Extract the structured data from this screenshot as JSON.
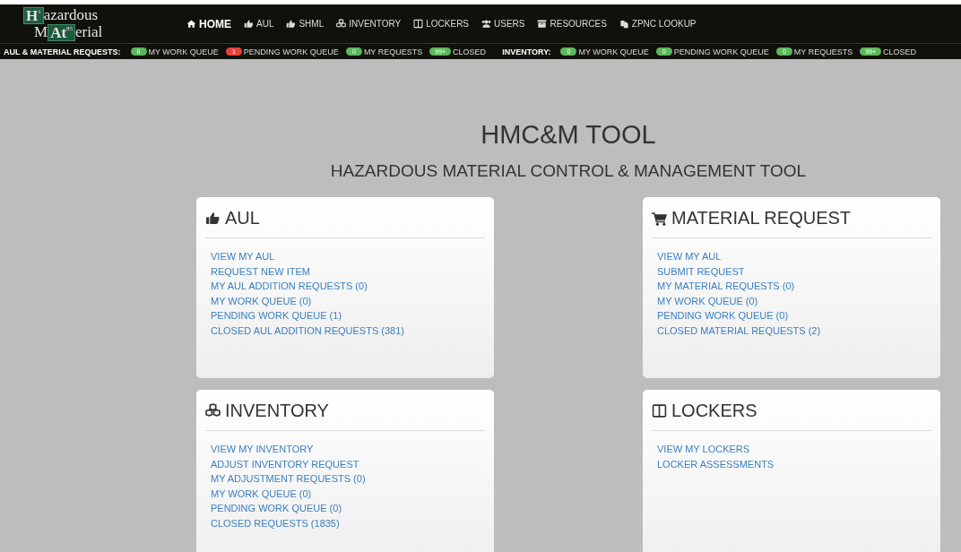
{
  "logo": {
    "lines": [
      {
        "boxed": "H",
        "mark": "1",
        "after": "azardous"
      },
      {
        "before": "M",
        "boxed": "At",
        "mark": "85",
        "after": "erial"
      }
    ]
  },
  "nav": [
    {
      "label": "HOME",
      "kind": "home",
      "selected": true
    },
    {
      "label": "AUL",
      "kind": "thumb",
      "selected": false
    },
    {
      "label": "SHML",
      "kind": "thumb",
      "selected": false
    },
    {
      "label": "INVENTORY",
      "kind": "cubes",
      "selected": false
    },
    {
      "label": "LOCKERS",
      "kind": "columns",
      "selected": false
    },
    {
      "label": "USERS",
      "kind": "users",
      "selected": false
    },
    {
      "label": "RESOURCES",
      "kind": "archive",
      "selected": false
    },
    {
      "label": "ZPNC LOOKUP",
      "kind": "copy",
      "selected": false
    }
  ],
  "status_bar": [
    {
      "label": "AUL & MATERIAL REQUESTS:",
      "items": [
        {
          "count": "0",
          "color": "#5cb85c",
          "text": "MY WORK QUEUE"
        },
        {
          "count": "1",
          "color": "#e8433a",
          "text": "PENDING WORK QUEUE"
        },
        {
          "count": "0",
          "color": "#5cb85c",
          "text": "MY REQUESTS"
        },
        {
          "count": "99+",
          "color": "#5cb85c",
          "text": "CLOSED"
        }
      ]
    },
    {
      "label": "INVENTORY:",
      "items": [
        {
          "count": "0",
          "color": "#5cb85c",
          "text": "MY WORK QUEUE"
        },
        {
          "count": "0",
          "color": "#5cb85c",
          "text": "PENDING WORK QUEUE"
        },
        {
          "count": "0",
          "color": "#5cb85c",
          "text": "MY REQUESTS"
        },
        {
          "count": "99+",
          "color": "#5cb85c",
          "text": "CLOSED"
        }
      ]
    }
  ],
  "title": "HMC&M TOOL",
  "subtitle": "HAZARDOUS MATERIAL CONTROL & MANAGEMENT TOOL",
  "cards": [
    {
      "title": "AUL",
      "kind": "thumb",
      "links": [
        "VIEW MY AUL",
        "REQUEST NEW ITEM",
        "MY AUL ADDITION REQUESTS (0)",
        "MY WORK QUEUE (0)",
        "PENDING WORK QUEUE (1)",
        "CLOSED AUL ADDITION REQUESTS (381)"
      ]
    },
    {
      "title": "MATERIAL REQUEST",
      "kind": "cart",
      "links": [
        "VIEW MY AUL",
        "SUBMIT REQUEST",
        "MY MATERIAL REQUESTS (0)",
        "MY WORK QUEUE (0)",
        "PENDING WORK QUEUE (0)",
        "CLOSED MATERIAL REQUESTS (2)"
      ]
    },
    {
      "title": "INVENTORY",
      "kind": "cubes",
      "links": [
        "VIEW MY INVENTORY",
        "ADJUST INVENTORY REQUEST",
        "MY ADJUSTMENT REQUESTS (0)",
        "MY WORK QUEUE (0)",
        "PENDING WORK QUEUE (0)",
        "CLOSED REQUESTS (1835)"
      ]
    },
    {
      "title": "LOCKERS",
      "kind": "columns",
      "links": [
        "VIEW MY LOCKERS",
        "LOCKER ASSESSMENTS"
      ]
    }
  ]
}
